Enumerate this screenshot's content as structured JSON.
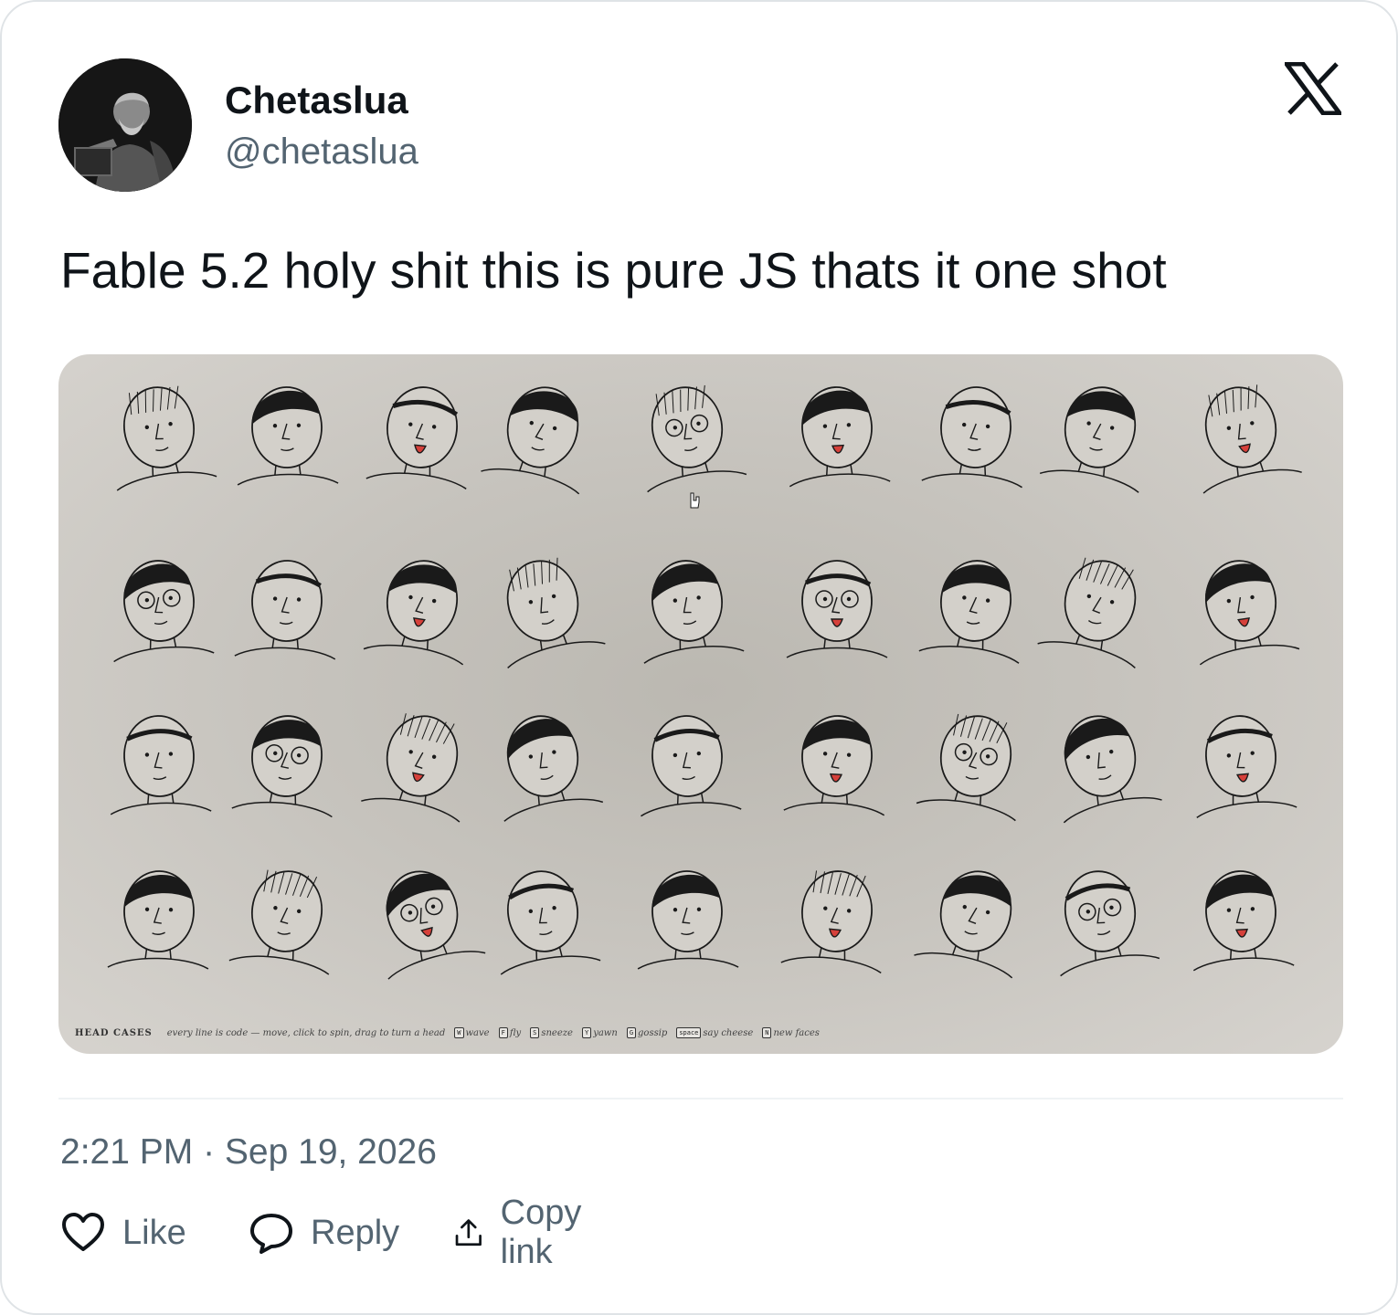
{
  "author": {
    "display_name": "Chetaslua",
    "handle": "@chetaslua",
    "avatar_icon": "avatar-philosopher-icon"
  },
  "brand_icon": "x-logo-icon",
  "tweet": {
    "text": "Fable 5.2 holy shit this is pure JS thats it one shot",
    "timestamp": "2:21 PM · Sep 19, 2026"
  },
  "media": {
    "app_title": "HEAD CASES",
    "subtitle": "every line is code — move, click to spin, drag to turn a head",
    "controls": [
      {
        "key": "W",
        "label": "wave"
      },
      {
        "key": "F",
        "label": "fly"
      },
      {
        "key": "S",
        "label": "sneeze"
      },
      {
        "key": "Y",
        "label": "yawn"
      },
      {
        "key": "G",
        "label": "gossip"
      },
      {
        "key": "space",
        "label": "say cheese"
      },
      {
        "key": "N",
        "label": "new faces"
      }
    ],
    "colors": {
      "ink": "#1a1a1a",
      "paper": "#c6c3bd",
      "tongue": "#d6403a"
    }
  },
  "actions": {
    "like": {
      "label": "Like",
      "icon": "heart-icon"
    },
    "reply": {
      "label": "Reply",
      "icon": "speech-bubble-icon"
    },
    "copy": {
      "label": "Copy link",
      "icon": "upload-arrow-icon"
    }
  }
}
